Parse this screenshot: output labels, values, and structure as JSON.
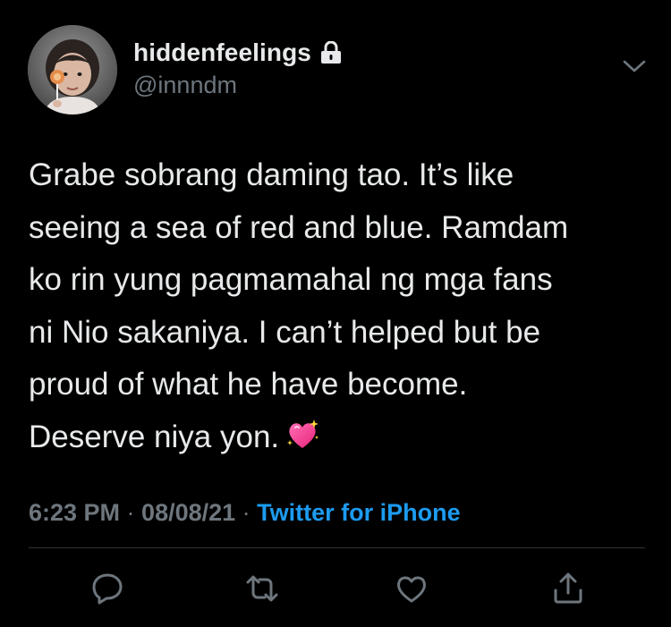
{
  "user": {
    "display_name": "hiddenfeelings",
    "handle": "@innndm",
    "protected": true
  },
  "tweet": {
    "text": "Grabe sobrang daming tao. It’s like\nseeing a sea of red and blue. Ramdam\nko rin yung pagmamahal ng mga fans\nni Nio sakaniya. I can’t helped but be\nproud of what he have become.\nDeserve niya yon.",
    "emoji": "sparkling-heart"
  },
  "meta": {
    "time": "6:23 PM",
    "separator": " · ",
    "date": "08/08/21",
    "source": "Twitter for iPhone"
  },
  "actions": [
    "reply-icon",
    "retweet-icon",
    "like-icon",
    "share-icon"
  ],
  "colors": {
    "background": "#000000",
    "text": "#e7e9ea",
    "secondary": "#6e767d",
    "link": "#1d9bf0",
    "divider": "#2f3336"
  }
}
